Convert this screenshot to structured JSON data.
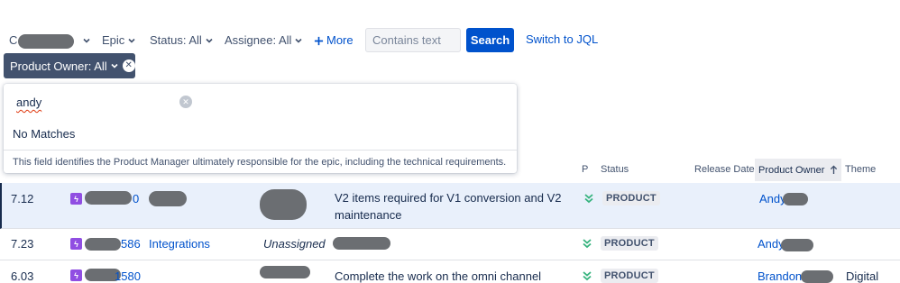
{
  "filters": {
    "project_label": "C",
    "epic_label": "Epic",
    "status_label": "Status: All",
    "assignee_label": "Assignee: All",
    "more_label": "More",
    "search_placeholder": "Contains text",
    "search_button": "Search",
    "jql_link": "Switch to JQL",
    "product_owner_chip": "Product Owner: All"
  },
  "dropdown": {
    "query": "andy",
    "no_matches": "No Matches",
    "help": "This field identifies the Product Manager ultimately responsible for the epic, including the technical requirements."
  },
  "columns": {
    "p": "P",
    "status": "Status",
    "release_date": "Release Date",
    "product_owner": "Product Owner",
    "theme": "Theme"
  },
  "rows": [
    {
      "rank": "7.12",
      "key_suffix": "0",
      "summary_line1": "V2 items required for V1 conversion and V2",
      "summary_line2": "maintenance",
      "status": "PRODUCT",
      "product_owner": "Andy",
      "theme": ""
    },
    {
      "rank": "7.23",
      "key_suffix": "586",
      "component": "Integrations",
      "assignee": "Unassigned",
      "summary_line1": "",
      "status": "PRODUCT",
      "product_owner": "Andy",
      "theme": ""
    },
    {
      "rank": "6.03",
      "key_suffix": "1580",
      "summary_line1": "Complete the work on the omni channel",
      "status": "PRODUCT",
      "product_owner": "Brandon",
      "theme": "Digital"
    }
  ],
  "colors": {
    "primary": "#0052cc",
    "chip_bg": "#42526e",
    "epic": "#904ee2",
    "priority_low": "#36b37e",
    "selected_row": "#e9f0fb"
  },
  "icons": {
    "chevron": "chevron-down-icon",
    "plus": "plus-icon",
    "clear": "clear-icon",
    "epic": "epic-lightning-icon",
    "priority": "priority-lowest-icon",
    "sort": "sort-up-arrow-icon"
  }
}
